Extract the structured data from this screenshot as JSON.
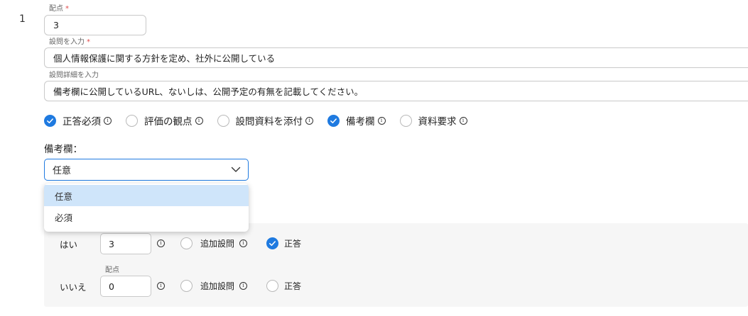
{
  "question": {
    "number": "1",
    "score_label": "配点",
    "score_value": "3",
    "question_label": "設問を入力",
    "question_value": "個人情報保護に関する方針を定め、社外に公開している",
    "detail_label": "設問詳細を入力",
    "detail_value": "備考欄に公開しているURL、ないしは、公開予定の有無を記載してください。",
    "required_mark": "*"
  },
  "options": [
    {
      "label": "正答必須",
      "checked": true
    },
    {
      "label": "評価の観点",
      "checked": false
    },
    {
      "label": "設問資料を添付",
      "checked": false
    },
    {
      "label": "備考欄",
      "checked": true
    },
    {
      "label": "資料要求",
      "checked": false
    }
  ],
  "remarks": {
    "label": "備考欄：",
    "selected": "任意",
    "dropdown_options": [
      "任意",
      "必須"
    ]
  },
  "answers": {
    "score_label": "配点",
    "rows": [
      {
        "label": "はい",
        "score": "3",
        "followup_label": "追加設問",
        "followup_checked": false,
        "correct_label": "正答",
        "correct_checked": true
      },
      {
        "label": "いいえ",
        "score": "0",
        "followup_label": "追加設問",
        "followup_checked": false,
        "correct_label": "正答",
        "correct_checked": false
      }
    ]
  },
  "colors": {
    "accent": "#1f7ae0",
    "selected_option_bg": "#cfe5fa",
    "required": "#e04b4b"
  }
}
